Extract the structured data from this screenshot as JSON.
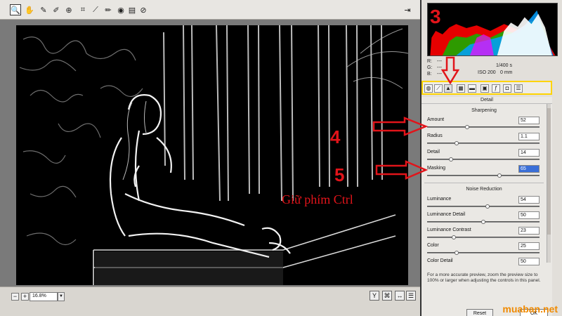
{
  "toolbar": {
    "tools": [
      "zoom-tool",
      "hand-tool",
      "white-balance-tool",
      "color-sampler-tool",
      "target-adjustment-tool",
      "crop-tool",
      "straighten-tool",
      "spot-removal-tool",
      "red-eye-tool",
      "preferences-tool",
      "rotate-tool"
    ]
  },
  "zoom": {
    "value": "16.8%",
    "minus": "−",
    "plus": "+"
  },
  "readout": {
    "r": "R:",
    "g": "G:",
    "b": "B:",
    "dash1": "---",
    "dash2": "---",
    "dash3": "---",
    "exposure": "1/400 s",
    "iso": "ISO 200",
    "focal": "0 mm"
  },
  "panel": {
    "tab_icons": [
      "basic-icon",
      "tone-curve-icon",
      "detail-icon",
      "hsl-icon",
      "split-toning-icon",
      "lens-corrections-icon",
      "effects-icon",
      "camera-calibration-icon",
      "presets-icon"
    ],
    "title": "Detail",
    "sharpening": {
      "title": "Sharpening",
      "amount": {
        "label": "Amount",
        "value": "52",
        "level": 0.35
      },
      "radius": {
        "label": "Radius",
        "value": "1.1",
        "level": 0.25
      },
      "detail": {
        "label": "Detail",
        "value": "14",
        "level": 0.2
      },
      "masking": {
        "label": "Masking",
        "value": "65",
        "level": 0.65
      }
    },
    "noise": {
      "title": "Noise Reduction",
      "luminance": {
        "label": "Luminance",
        "value": "54",
        "level": 0.54
      },
      "luminance_detail": {
        "label": "Luminance Detail",
        "value": "50",
        "level": 0.5
      },
      "luminance_contrast": {
        "label": "Luminance Contrast",
        "value": "23",
        "level": 0.23
      },
      "color": {
        "label": "Color",
        "value": "25",
        "level": 0.25
      },
      "color_detail": {
        "label": "Color Detail",
        "value": "50",
        "level": 0.5
      }
    },
    "help": "For a more accurate preview, zoom the preview size to 100% or larger when adjusting the controls in this panel."
  },
  "buttons": {
    "reset": "Reset",
    "ok": "OK"
  },
  "annotations": {
    "n3": "3",
    "n4": "4",
    "n5": "5",
    "caption": "Giữ phím Ctrl",
    "color": "#e1141a"
  },
  "watermark": "muaban.net"
}
